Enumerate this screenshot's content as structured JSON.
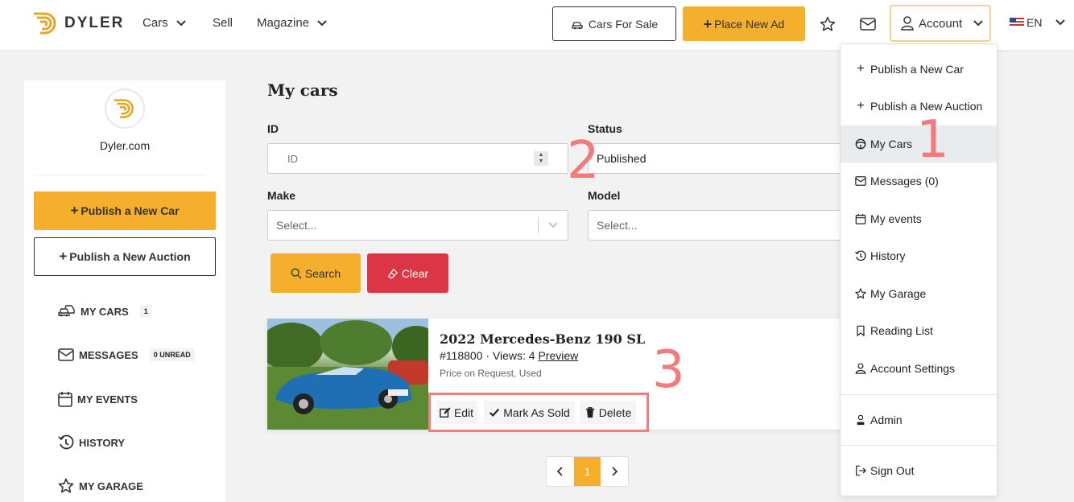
{
  "header": {
    "brand": "DYLER",
    "nav": [
      {
        "label": "Cars",
        "has_dropdown": true
      },
      {
        "label": "Sell",
        "has_dropdown": false
      },
      {
        "label": "Magazine",
        "has_dropdown": true
      }
    ],
    "cars_for_sale_label": "Cars For Sale",
    "place_ad_label": "Place New Ad",
    "account_label": "Account",
    "language": "EN"
  },
  "sidebar": {
    "site_name": "Dyler.com",
    "publish_car_label": "Publish a New Car",
    "publish_auction_label": "Publish a New Auction",
    "items": [
      {
        "label": "MY CARS",
        "badge": "1",
        "icon": "cars-icon"
      },
      {
        "label": "MESSAGES",
        "badge": "0 UNREAD",
        "icon": "mail-icon"
      },
      {
        "label": "MY EVENTS",
        "badge": "",
        "icon": "calendar-icon"
      },
      {
        "label": "HISTORY",
        "badge": "",
        "icon": "history-icon"
      },
      {
        "label": "MY GARAGE",
        "badge": "",
        "icon": "star-icon"
      }
    ]
  },
  "main": {
    "title": "My cars",
    "filters": {
      "id_label": "ID",
      "id_placeholder": "ID",
      "status_label": "Status",
      "status_value": "Published",
      "make_label": "Make",
      "make_placeholder": "Select...",
      "model_label": "Model",
      "model_placeholder": "Select..."
    },
    "search_label": "Search",
    "clear_label": "Clear",
    "listing": {
      "title": "2022 Mercedes-Benz 190 SL",
      "meta": "#118800 · Views: 4",
      "preview_label": "Preview",
      "price": "Price on Request, Used",
      "edit_label": "Edit",
      "sold_label": "Mark As Sold",
      "delete_label": "Delete"
    },
    "pagination": {
      "current": "1"
    }
  },
  "account_menu": {
    "items": [
      {
        "label": "Publish a New Car",
        "icon": "plus-icon"
      },
      {
        "label": "Publish a New Auction",
        "icon": "plus-icon"
      },
      {
        "label": "My Cars",
        "icon": "steering-wheel-icon"
      },
      {
        "label": "Messages (0)",
        "icon": "mail-icon"
      },
      {
        "label": "My events",
        "icon": "calendar-icon"
      },
      {
        "label": "History",
        "icon": "history-icon"
      },
      {
        "label": "My Garage",
        "icon": "star-icon"
      },
      {
        "label": "Reading List",
        "icon": "bookmark-icon"
      },
      {
        "label": "Account Settings",
        "icon": "user-icon"
      },
      {
        "label": "Admin",
        "icon": "admin-icon"
      },
      {
        "label": "Sign Out",
        "icon": "sign-out-icon"
      }
    ]
  },
  "annotations": [
    "1",
    "2",
    "3"
  ],
  "colors": {
    "accent": "#f6ae2d",
    "danger": "#dc3545",
    "annotation": "#f47b7b"
  }
}
